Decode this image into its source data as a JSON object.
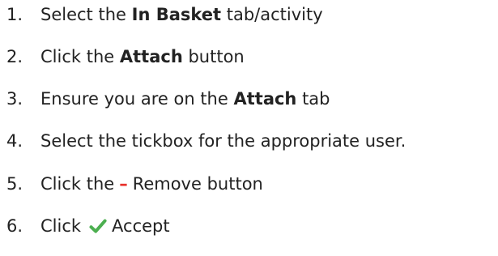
{
  "steps": [
    {
      "number": "1.",
      "pre": "Select the",
      "bold": "In Basket",
      "post": "tab/activity"
    },
    {
      "number": "2.",
      "pre": "Click the",
      "bold": "Attach",
      "post": "button"
    },
    {
      "number": "3.",
      "pre": "Ensure you are on the",
      "bold": "Attach",
      "post": "tab"
    },
    {
      "number": "4.",
      "text": "Select the tickbox for the appropriate user."
    },
    {
      "number": "5.",
      "pre": "Click the",
      "symbol": "–",
      "post": "Remove button"
    },
    {
      "number": "6.",
      "pre": "Click",
      "post": "Accept"
    }
  ],
  "icons": {
    "minus_color": "#e8312b",
    "check_color": "#4caf50",
    "check_icon": "check-icon"
  }
}
